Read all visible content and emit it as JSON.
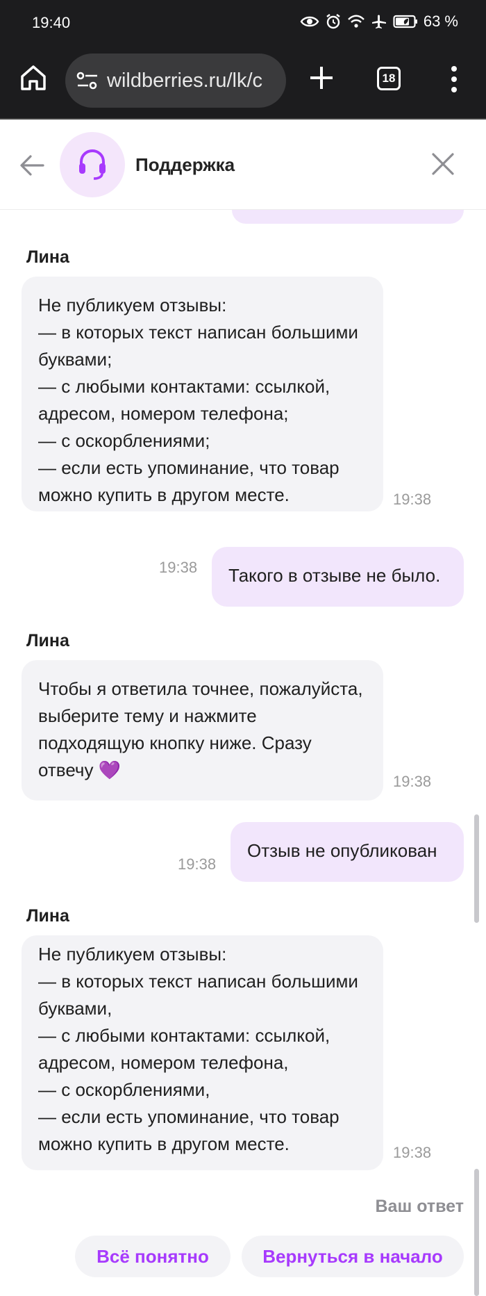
{
  "status_bar": {
    "time": "19:40",
    "battery_percent": "63 %"
  },
  "browser": {
    "url": "wildberries.ru/lk/c",
    "tab_count": "18"
  },
  "chat_header": {
    "title": "Поддержка"
  },
  "messages": [
    {
      "type": "incoming",
      "sender": "Лина",
      "text": "Не публикуем отзывы:\n— в которых текст написан большими буквами;\n— с любыми контактами: ссылкой, адресом, номером телефона;\n— с оскорблениями;\n— если есть упоминание, что товар можно купить в другом месте.",
      "time": "19:38"
    },
    {
      "type": "outgoing",
      "text": "Такого в отзыве не было.",
      "time": "19:38"
    },
    {
      "type": "incoming",
      "sender": "Лина",
      "text": "Чтобы я ответила точнее, пожалуйста, выберите тему и нажмите подходящую кнопку ниже. Сразу отвечу",
      "emoji": "💜",
      "time": "19:38"
    },
    {
      "type": "outgoing",
      "text": "Отзыв не опубликован",
      "time": "19:38"
    },
    {
      "type": "incoming",
      "sender": "Лина",
      "text": "Не публикуем отзывы:\n— в которых текст написан большими буквами,\n— с любыми контактами: ссылкой, адресом, номером телефона,\n— с оскорблениями,\n— если есть упоминание, что товар можно купить в другом месте.",
      "time": "19:38"
    }
  ],
  "answer_section": {
    "label": "Ваш ответ",
    "buttons": [
      "Всё понятно",
      "Вернуться в начало"
    ]
  },
  "colors": {
    "accent": "#a73afd",
    "outgoing_bubble": "#f2e6fc",
    "incoming_bubble": "#f3f3f6",
    "avatar_bg": "#f4e6fb"
  },
  "icons": [
    "eye-icon",
    "alarm-icon",
    "wifi-icon",
    "airplane-mode-icon",
    "battery-icon",
    "home-icon",
    "site-settings-icon",
    "new-tab-icon",
    "tab-switcher-icon",
    "more-menu-icon",
    "back-arrow-icon",
    "headset-icon",
    "close-icon"
  ]
}
